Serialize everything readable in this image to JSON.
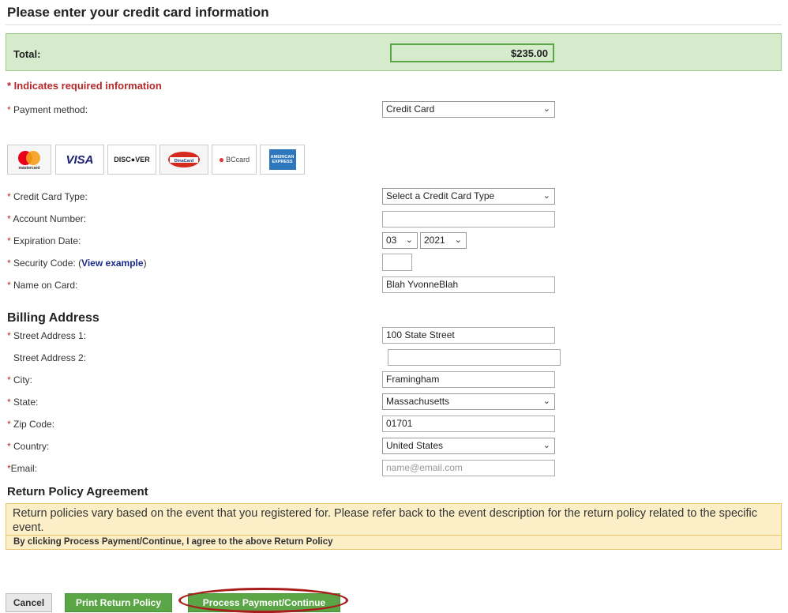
{
  "page": {
    "title": "Please enter your credit card information",
    "total_label": "Total:",
    "total_value": "$235.00",
    "required_note": "* Indicates required information"
  },
  "payment": {
    "method_label": "Payment method:",
    "method_value": "Credit Card"
  },
  "cards": [
    "mastercard",
    "VISA",
    "DISC●VER",
    "DinaCard",
    "BCcard",
    "AMERICAN EXPRESS"
  ],
  "card_form": {
    "type_label": "Credit Card Type:",
    "type_value": "Select a Credit Card Type",
    "account_label": "Account Number:",
    "account_value": "",
    "expiration_label": "Expiration Date:",
    "exp_month": "03",
    "exp_year": "2021",
    "security_label": "Security Code:",
    "security_open": "(",
    "view_example": "View example",
    "security_close": ")",
    "security_value": "",
    "name_label": "Name on Card:",
    "name_value": "Blah YvonneBlah"
  },
  "billing": {
    "heading": "Billing Address",
    "street1_label": "Street Address 1:",
    "street1_value": "100 State Street",
    "street2_label": "Street Address 2:",
    "street2_value": "",
    "city_label": "City:",
    "city_value": "Framingham",
    "state_label": "State:",
    "state_value": "Massachusetts",
    "zip_label": "Zip Code:",
    "zip_value": "01701",
    "country_label": "Country:",
    "country_value": "United States",
    "email_label": "Email:",
    "email_placeholder": "name@email.com"
  },
  "policy": {
    "heading": "Return Policy Agreement",
    "text": "Return policies vary based on the event that you registered for. Please refer back to the event description for the return policy related to the specific event.",
    "agreement": "By clicking Process Payment/Continue, I agree to the above Return Policy"
  },
  "buttons": {
    "cancel": "Cancel",
    "print": "Print Return Policy",
    "process": "Process Payment/Continue"
  },
  "colors": {
    "required_red": "#b32a2a",
    "button_green": "#5aa646",
    "total_bg": "#d5ebcc",
    "policy_bg": "#fcefc7",
    "highlight_ring": "#a81c1c"
  }
}
